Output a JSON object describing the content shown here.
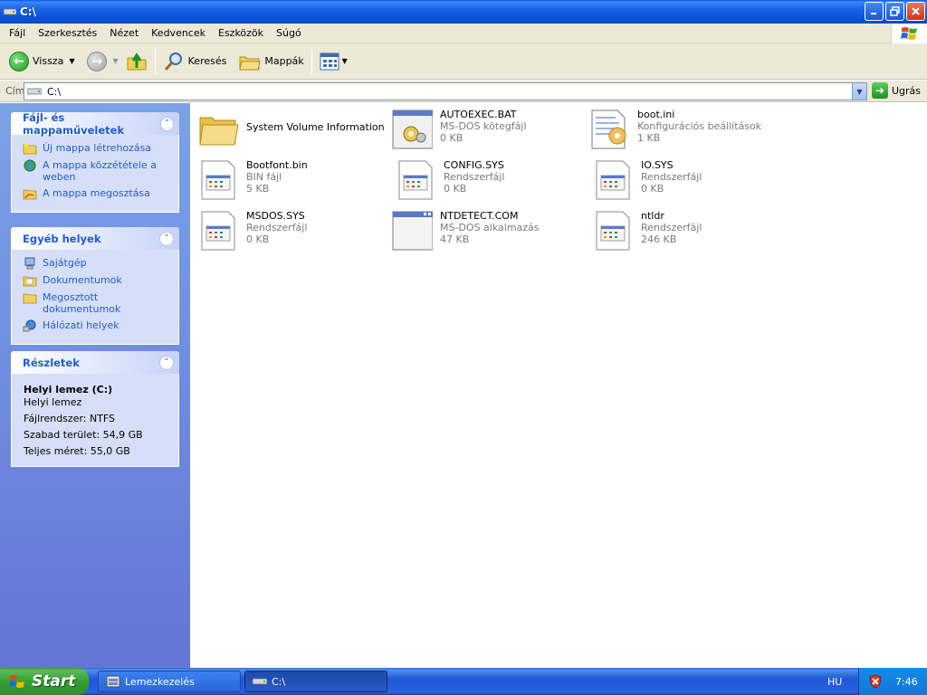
{
  "window": {
    "title": "C:\\"
  },
  "menu": [
    "Fájl",
    "Szerkesztés",
    "Nézet",
    "Kedvencek",
    "Eszközök",
    "Súgó"
  ],
  "toolbar": {
    "back_label": "Vissza",
    "search_label": "Keresés",
    "folders_label": "Mappák"
  },
  "address": {
    "label": "Cím",
    "value": "C:\\",
    "go_label": "Ugrás"
  },
  "panels": {
    "file_tasks": {
      "title": "Fájl- és mappaműveletek",
      "items": [
        "Új mappa létrehozása",
        "A mappa közzététele a weben",
        "A mappa megosztása"
      ]
    },
    "other_places": {
      "title": "Egyéb helyek",
      "items": [
        "Sajátgép",
        "Dokumentumok",
        "Megosztott dokumentumok",
        "Hálózati helyek"
      ]
    },
    "details": {
      "title": "Részletek",
      "name": "Helyi lemez (C:)",
      "type": "Helyi lemez",
      "filesystem": "Fájlrendszer: NTFS",
      "free": "Szabad terület: 54,9 GB",
      "total": "Teljes méret: 55,0 GB"
    }
  },
  "files": [
    {
      "name": "System Volume Information",
      "type": "",
      "size": ""
    },
    {
      "name": "AUTOEXEC.BAT",
      "type": "MS-DOS kötegfájl",
      "size": "0 KB"
    },
    {
      "name": "boot.ini",
      "type": "Konfigurációs beállítások",
      "size": "1 KB"
    },
    {
      "name": "Bootfont.bin",
      "type": "BIN fájl",
      "size": "5 KB"
    },
    {
      "name": "CONFIG.SYS",
      "type": "Rendszerfájl",
      "size": "0 KB"
    },
    {
      "name": "IO.SYS",
      "type": "Rendszerfájl",
      "size": "0 KB"
    },
    {
      "name": "MSDOS.SYS",
      "type": "Rendszerfájl",
      "size": "0 KB"
    },
    {
      "name": "NTDETECT.COM",
      "type": "MS-DOS alkalmazás",
      "size": "47 KB"
    },
    {
      "name": "ntldr",
      "type": "Rendszerfájl",
      "size": "246 KB"
    }
  ],
  "taskbar": {
    "start_label": "Start",
    "tasks": [
      "Lemezkezelés",
      "C:\\"
    ],
    "language": "HU",
    "clock": "7:46"
  }
}
